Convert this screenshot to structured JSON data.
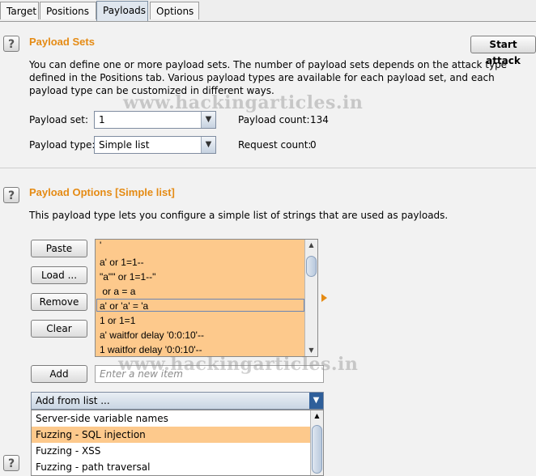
{
  "tabs": [
    "Target",
    "Positions",
    "Payloads",
    "Options"
  ],
  "help_glyph": "?",
  "start_attack_label": "Start attack",
  "payload_sets": {
    "title": "Payload Sets",
    "description": [
      "You can define one or more payload sets. The number of payload sets depends on the attack type",
      "defined in the Positions tab. Various payload types are available for each payload set, and each",
      "payload type can be customized in different ways."
    ],
    "set_label": "Payload set:",
    "set_value": "1",
    "type_label": "Payload type:",
    "type_value": "Simple list",
    "count_label": "Payload count:",
    "count_value": "134",
    "request_label": "Request count:",
    "request_value": "0"
  },
  "payload_options": {
    "title": "Payload Options [Simple list]",
    "description": "This payload type lets you configure a simple list of strings that are used as payloads.",
    "buttons": {
      "paste": "Paste",
      "load": "Load ...",
      "remove": "Remove",
      "clear": "Clear",
      "add": "Add"
    },
    "list_items": [
      "'",
      "a' or 1=1--",
      "\"a\"\" or 1=1--\"",
      " or a = a",
      "a' or 'a' = 'a",
      "1 or 1=1",
      "a' waitfor delay '0:0:10'--",
      "1 waitfor delay '0:0:10'--"
    ],
    "selected_index": 4,
    "add_placeholder": "Enter a new item",
    "add_from_list_label": "Add from list ...",
    "dropdown_options": [
      "Server-side variable names",
      "Fuzzing - SQL injection",
      "Fuzzing - XSS",
      "Fuzzing - path traversal"
    ],
    "dropdown_selected_index": 1
  },
  "watermark": "www.hackingarticles.in",
  "colors": {
    "accent": "#e58b14",
    "list_bg": "#fdc98c",
    "page_bg": "#f2f2f2"
  },
  "icons": {
    "help": "question-mark-icon",
    "combo_arrow": "chevron-down-icon",
    "scroll_up": "arrow-up-icon",
    "scroll_down": "arrow-down-icon",
    "expand": "triangle-right-icon"
  }
}
